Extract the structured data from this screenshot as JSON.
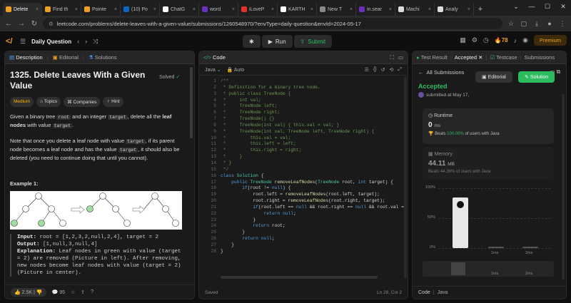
{
  "browser": {
    "tabs": [
      {
        "label": "Delete",
        "color": "#f0a020",
        "active": true
      },
      {
        "label": "Find th",
        "color": "#f0a020"
      },
      {
        "label": "Pointe",
        "color": "#f0a020"
      },
      {
        "label": "(10) Po",
        "color": "#0a66c2"
      },
      {
        "label": "ChatG",
        "color": "#ffffff"
      },
      {
        "label": "word",
        "color": "#6b2fbf"
      },
      {
        "label": "iLoveP",
        "color": "#e5322d"
      },
      {
        "label": "KARTH",
        "color": "#ffffff"
      },
      {
        "label": "New T",
        "color": "#888888"
      },
      {
        "label": "in.sear",
        "color": "#6b2fbf"
      },
      {
        "label": "Machi",
        "color": "#dddddd"
      },
      {
        "label": "Analy",
        "color": "#dddddd"
      }
    ],
    "new_tab": "+",
    "url": "leetcode.com/problems/delete-leaves-with-a-given-value/submissions/1260548970/?envType=daily-question&envId=2024-05-17"
  },
  "header": {
    "title": "Daily Question",
    "run": "Run",
    "submit": "Submit",
    "streak": "78",
    "premium": "Premium"
  },
  "left": {
    "tabs": [
      "Description",
      "Editorial",
      "Solutions"
    ],
    "title": "1325. Delete Leaves With a Given Value",
    "solved": "Solved",
    "chips": [
      "Medium",
      "Topics",
      "Companies",
      "Hint"
    ],
    "p1a": "Given a binary tree ",
    "p1b": "root",
    "p1c": " and an integer ",
    "p1d": "target",
    "p1e": ", delete all the ",
    "p1f": "leaf nodes",
    "p1g": " with value ",
    "p1h": "target",
    "p1i": ".",
    "p2a": "Note that once you delete a leaf node with value ",
    "p2b": "target",
    "p2c": ", if its parent node becomes a leaf node and has the value ",
    "p2d": "target",
    "p2e": ", it should also be deleted (you need to continue doing that until you cannot).",
    "example_title": "Example 1:",
    "input_label": "Input:",
    "input_val": " root = [1,2,3,2,null,2,4], target = 2",
    "output_label": "Output:",
    "output_val": " [1,null,3,null,4]",
    "expl_label": "Explanation:",
    "expl_val": " Leaf nodes in green with value (target = 2) are removed (Picture in left). After removing, new nodes become leaf nodes with value (target = 2) (Picture in center).",
    "likes": "2.5K",
    "comments": "95"
  },
  "code": {
    "tab": "Code",
    "language": "Java",
    "mode": "Auto",
    "saved": "Saved",
    "cursor": "Ln 28, Col 2",
    "lines": [
      "/**",
      " * Definition for a binary tree node.",
      " * public class TreeNode {",
      " *     int val;",
      " *     TreeNode left;",
      " *     TreeNode right;",
      " *     TreeNode() {}",
      " *     TreeNode(int val) { this.val = val; }",
      " *     TreeNode(int val, TreeNode left, TreeNode right) {",
      " *         this.val = val;",
      " *         this.left = left;",
      " *         this.right = right;",
      " *     }",
      " * }",
      " */",
      "class Solution {",
      "    public TreeNode removeLeafNodes(TreeNode root, int target) {",
      "        if(root != null) {",
      "            root.left = removeLeafNodes(root.left, target);",
      "            root.right = removeLeafNodes(root.right, target);",
      "            if(root.left == null && root.right == null && root.val == target) {",
      "                return null;",
      "            }",
      "            return root;",
      "        }",
      "        return null;",
      "    }",
      "}"
    ]
  },
  "right": {
    "tabs": [
      "Test Result",
      "Accepted",
      "Testcase",
      "Submissions"
    ],
    "all_submissions": "All Submissions",
    "status": "Accepted",
    "submitted": "submitted at May 17,",
    "editorial_btn": "Editorial",
    "solution_btn": "Solution",
    "runtime_label": "Runtime",
    "runtime_val": "0",
    "runtime_unit": "ms",
    "runtime_beats_a": "Beats ",
    "runtime_beats_b": "100.00%",
    "runtime_beats_c": " of users with Java",
    "memory_label": "Memory",
    "memory_val": "44.11",
    "memory_unit": "MB",
    "memory_beats": "Beats 44.36% of users with Java",
    "chart": {
      "ticks": [
        "100%",
        "50%",
        "0%"
      ],
      "xlabels": [
        "1ms",
        "2ms"
      ],
      "mini_labels": [
        "1ms",
        "2ms"
      ]
    },
    "code_label": "Code",
    "code_lang": "Java"
  }
}
